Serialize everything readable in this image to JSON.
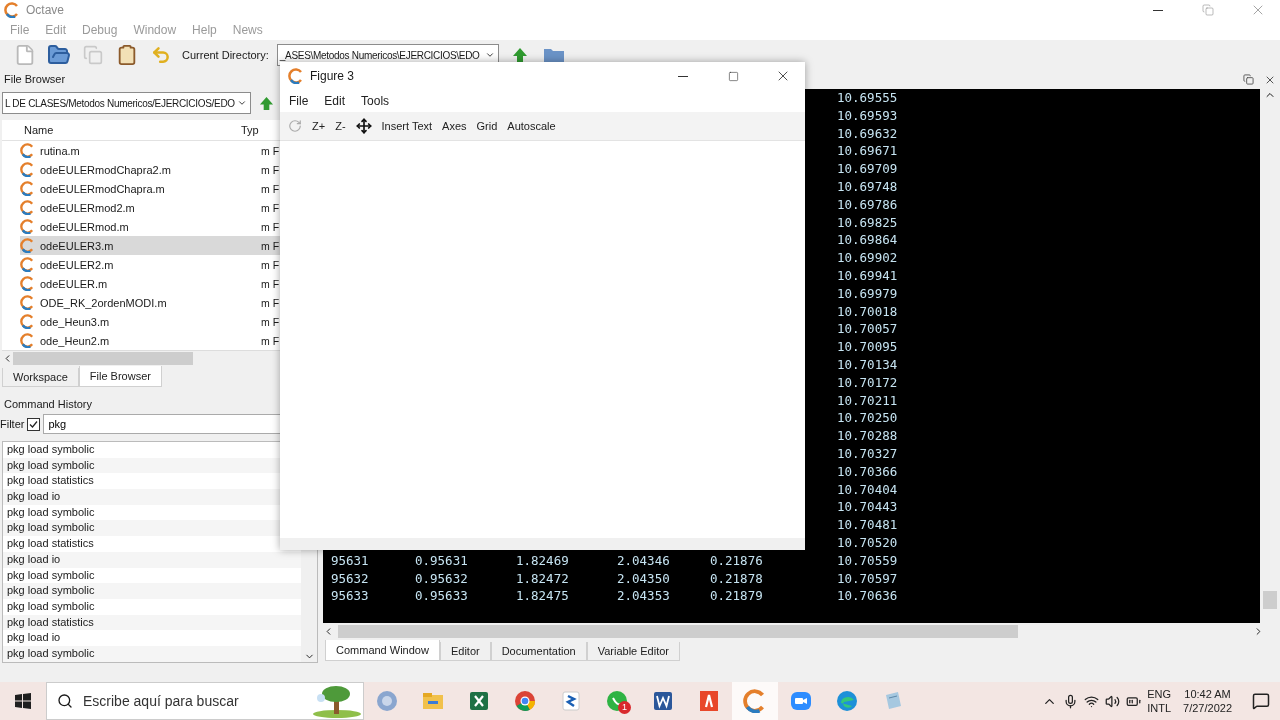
{
  "window": {
    "title": "Octave"
  },
  "menu": [
    "File",
    "Edit",
    "Debug",
    "Window",
    "Help",
    "News"
  ],
  "toolbar": {
    "directory_label": "Current Directory:",
    "directory": "_ASES\\Metodos Numericos\\EJERCICIOS\\EDO"
  },
  "file_browser": {
    "title": "File Browser",
    "path": "L DE CLASES/Metodos Numericos/EJERCICIOS/EDO",
    "columns": [
      "Name",
      "Typ"
    ],
    "files": [
      {
        "name": "rutina.m",
        "type": "m F",
        "selected": false
      },
      {
        "name": "odeEULERmodChapra2.m",
        "type": "m F",
        "selected": false
      },
      {
        "name": "odeEULERmodChapra.m",
        "type": "m F",
        "selected": false
      },
      {
        "name": "odeEULERmod2.m",
        "type": "m F",
        "selected": false
      },
      {
        "name": "odeEULERmod.m",
        "type": "m F",
        "selected": false
      },
      {
        "name": "odeEULER3.m",
        "type": "m F",
        "selected": true
      },
      {
        "name": "odeEULER2.m",
        "type": "m F",
        "selected": false
      },
      {
        "name": "odeEULER.m",
        "type": "m F",
        "selected": false
      },
      {
        "name": "ODE_RK_2ordenMODI.m",
        "type": "m F",
        "selected": false
      },
      {
        "name": "ode_Heun3.m",
        "type": "m F",
        "selected": false
      },
      {
        "name": "ode_Heun2.m",
        "type": "m F",
        "selected": false
      }
    ]
  },
  "left_tabs": [
    {
      "label": "Workspace",
      "selected": false
    },
    {
      "label": "File Browser",
      "selected": true
    }
  ],
  "command_history": {
    "title": "Command History",
    "filter_label": "Filter",
    "filter_checked": true,
    "filter": "pkg",
    "entries": [
      "pkg load symbolic",
      "pkg load symbolic",
      "pkg load statistics",
      "pkg load io",
      "pkg load symbolic",
      "pkg load symbolic",
      "pkg load statistics",
      "pkg load io",
      "pkg load symbolic",
      "pkg load symbolic",
      "pkg load symbolic",
      "pkg load statistics",
      "pkg load io",
      "pkg load symbolic"
    ]
  },
  "command_window": {
    "rows": [
      {
        "values": [
          "10.69555"
        ]
      },
      {
        "values": [
          "10.69593"
        ]
      },
      {
        "values": [
          "10.69632"
        ]
      },
      {
        "values": [
          "10.69671"
        ]
      },
      {
        "values": [
          "10.69709"
        ]
      },
      {
        "values": [
          "10.69748"
        ]
      },
      {
        "values": [
          "10.69786"
        ]
      },
      {
        "values": [
          "10.69825"
        ]
      },
      {
        "values": [
          "10.69864"
        ]
      },
      {
        "values": [
          "10.69902"
        ]
      },
      {
        "values": [
          "10.69941"
        ]
      },
      {
        "values": [
          "10.69979"
        ]
      },
      {
        "values": [
          "10.70018"
        ]
      },
      {
        "values": [
          "10.70057"
        ]
      },
      {
        "values": [
          "10.70095"
        ]
      },
      {
        "values": [
          "10.70134"
        ]
      },
      {
        "values": [
          "10.70172"
        ]
      },
      {
        "values": [
          "10.70211"
        ]
      },
      {
        "values": [
          "10.70250"
        ]
      },
      {
        "values": [
          "10.70288"
        ]
      },
      {
        "values": [
          "10.70327"
        ]
      },
      {
        "values": [
          "10.70366"
        ]
      },
      {
        "values": [
          "10.70404"
        ]
      },
      {
        "values": [
          "10.70443"
        ]
      },
      {
        "values": [
          "10.70481"
        ]
      },
      {
        "values": [
          "10.70520"
        ]
      },
      {
        "values": [
          "95631",
          "0.95631",
          "1.82469",
          "2.04346",
          "0.21876",
          "10.70559"
        ]
      },
      {
        "values": [
          "95632",
          "0.95632",
          "1.82472",
          "2.04350",
          "0.21878",
          "10.70597"
        ]
      },
      {
        "values": [
          "95633",
          "0.95633",
          "1.82475",
          "2.04353",
          "0.21879",
          "10.70636"
        ]
      }
    ]
  },
  "bottom_tabs": [
    {
      "label": "Command Window",
      "selected": true
    },
    {
      "label": "Editor",
      "selected": false
    },
    {
      "label": "Documentation",
      "selected": false
    },
    {
      "label": "Variable Editor",
      "selected": false
    }
  ],
  "figure": {
    "title": "Figure 3",
    "menu": [
      "File",
      "Edit",
      "Tools"
    ],
    "tools": [
      {
        "kind": "rotate"
      },
      {
        "kind": "text",
        "label": "Z+"
      },
      {
        "kind": "text",
        "label": "Z-"
      },
      {
        "kind": "pan"
      },
      {
        "kind": "text",
        "label": "Insert Text"
      },
      {
        "kind": "text",
        "label": "Axes"
      },
      {
        "kind": "text",
        "label": "Grid"
      },
      {
        "kind": "text",
        "label": "Autoscale"
      }
    ]
  },
  "taskbar": {
    "search_placeholder": "Escribe aquí para buscar",
    "apps": [
      {
        "kind": "r",
        "selected": false
      },
      {
        "kind": "files",
        "selected": false
      },
      {
        "kind": "excel",
        "selected": false
      },
      {
        "kind": "chrome",
        "selected": false
      },
      {
        "kind": "blue",
        "selected": false
      },
      {
        "kind": "chat",
        "selected": false,
        "badge": "1"
      },
      {
        "kind": "word",
        "selected": false
      },
      {
        "kind": "red",
        "selected": false
      },
      {
        "kind": "octave",
        "selected": true
      },
      {
        "kind": "zoom",
        "selected": false
      },
      {
        "kind": "edge",
        "selected": false
      },
      {
        "kind": "notes",
        "selected": false
      }
    ],
    "language": "ENG",
    "layout": "INTL",
    "time": "10:42 AM",
    "date": "7/27/2022"
  }
}
